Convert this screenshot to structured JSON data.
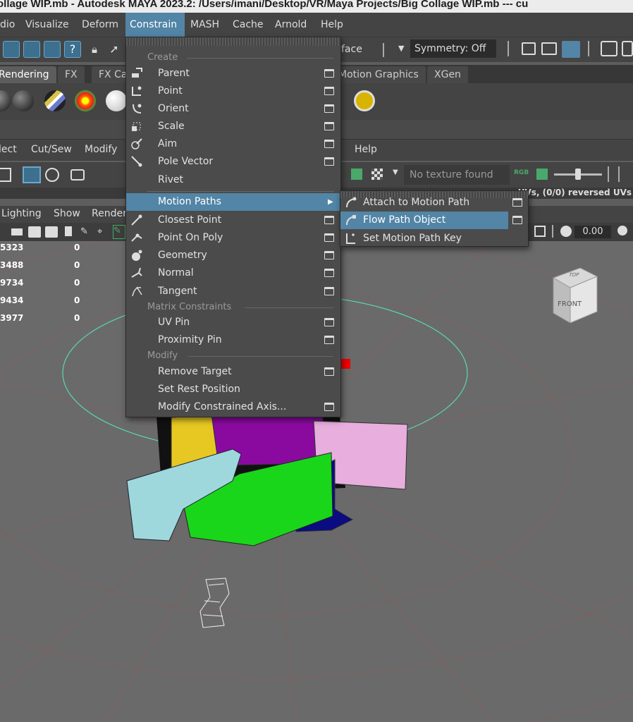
{
  "title": "ollage WIP.mb  -  Autodesk MAYA 2023.2: /Users/imani/Desktop/VR/Maya Projects/Big Collage WIP.mb   ---   cu",
  "menubar": [
    "dio",
    "Visualize",
    "Deform",
    "Constrain",
    "MASH",
    "Cache",
    "Arnold",
    "Help"
  ],
  "statusline": {
    "face_label": "face",
    "symmetry": "Symmetry: Off"
  },
  "shelf_tabs": [
    "Rendering",
    "FX",
    "FX Ca",
    "Motion Graphics",
    "XGen"
  ],
  "uv_menu": [
    "lect",
    "Cut/Sew",
    "Modify",
    "Help"
  ],
  "uv_texture": "No texture found",
  "uv_rgb": "RGB",
  "uv_status": "UVs, (0/0) reversed UVs",
  "panel_menu": [
    "Lighting",
    "Show",
    "Render"
  ],
  "panel_value": "0.00",
  "channel_rows": [
    {
      "a": "5323",
      "b": "0"
    },
    {
      "a": "3488",
      "b": "0"
    },
    {
      "a": "9734",
      "b": "0"
    },
    {
      "a": "9434",
      "b": "0"
    },
    {
      "a": "3977",
      "b": "0"
    }
  ],
  "viewcube": {
    "top": "TOP",
    "front": "FRONT"
  },
  "constrain_menu": {
    "header_create": "Create",
    "items_create": [
      "Parent",
      "Point",
      "Orient",
      "Scale",
      "Aim",
      "Pole Vector",
      "Rivet"
    ],
    "motion_paths": "Motion Paths",
    "items_create2": [
      "Closest Point",
      "Point On Poly",
      "Geometry",
      "Normal",
      "Tangent"
    ],
    "header_matrix": "Matrix Constraints",
    "items_matrix": [
      "UV Pin",
      "Proximity Pin"
    ],
    "header_modify": "Modify",
    "items_modify": [
      "Remove Target",
      "Set Rest Position",
      "Modify Constrained Axis..."
    ]
  },
  "motion_submenu": [
    "Attach to Motion Path",
    "Flow Path Object",
    "Set Motion Path Key"
  ],
  "colors": {
    "accent": "#5285a6",
    "menu_bg": "#4b4b4b",
    "viewport_bg": "#6a6a6a"
  }
}
